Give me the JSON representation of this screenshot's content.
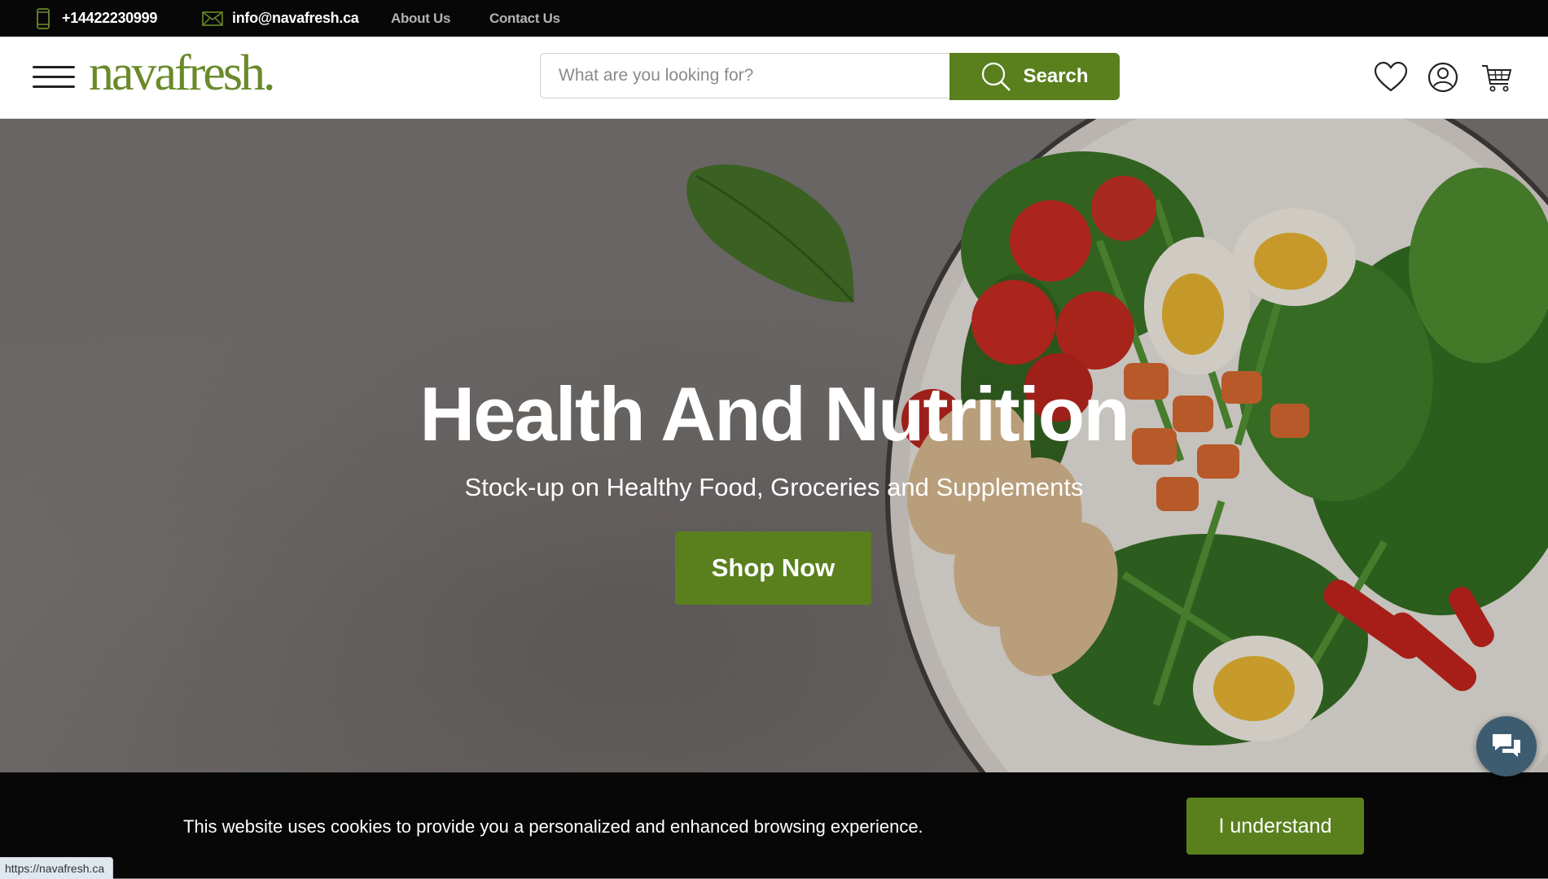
{
  "topbar": {
    "phone": "+14422230999",
    "email": "info@navafresh.ca",
    "about": "About Us",
    "contact": "Contact Us",
    "icons": [
      "phone-icon",
      "mail-icon"
    ]
  },
  "header": {
    "logo": "navafresh.",
    "search_placeholder": "What are you looking for?",
    "search_label": "Search",
    "icons": [
      "hamburger-menu-icon",
      "search-icon",
      "heart-icon",
      "user-icon",
      "cart-icon"
    ]
  },
  "hero": {
    "title": "Health And Nutrition",
    "subtitle": "Stock-up on Healthy Food, Groceries and Supplements",
    "cta": "Shop Now"
  },
  "cookie": {
    "text": "This website uses cookies to provide you a personalized and enhanced browsing experience.",
    "button": "I understand"
  },
  "chat": {
    "icon": "chat-icon"
  },
  "status_bar": {
    "url": "https://navafresh.ca"
  },
  "colors": {
    "brand_green": "#5a801e",
    "logo_green": "#6a8a2a",
    "topbar_bg": "#070707"
  }
}
